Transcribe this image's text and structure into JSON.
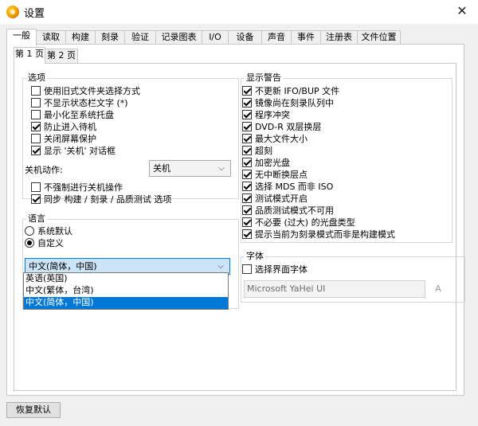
{
  "window": {
    "title": "设置",
    "close_glyph": "✕"
  },
  "tabs": [
    {
      "label": "一般",
      "active": true
    },
    {
      "label": "读取"
    },
    {
      "label": "构建"
    },
    {
      "label": "刻录"
    },
    {
      "label": "验证"
    },
    {
      "label": "记录图表"
    },
    {
      "label": "I/O"
    },
    {
      "label": "设备"
    },
    {
      "label": "声音"
    },
    {
      "label": "事件"
    },
    {
      "label": "注册表"
    },
    {
      "label": "文件位置"
    }
  ],
  "subtabs": [
    {
      "label": "第 1 页",
      "active": true
    },
    {
      "label": "第 2 页"
    }
  ],
  "options": {
    "legend": "选项",
    "items": [
      {
        "label": "使用旧式文件夹选择方式",
        "checked": false
      },
      {
        "label": "不显示状态栏文字 (*)",
        "checked": false
      },
      {
        "label": "最小化至系统托盘",
        "checked": false
      },
      {
        "label": "防止进入待机",
        "checked": true
      },
      {
        "label": "关闭屏幕保护",
        "checked": false
      },
      {
        "label": "显示 '关机' 对话框",
        "checked": true
      }
    ],
    "shutdown_label": "关机动作:",
    "shutdown_value": "关机",
    "items2": [
      {
        "label": "不强制进行关机操作",
        "checked": false
      },
      {
        "label": "同步 构建 / 刻录 / 品质测试 选项",
        "checked": true
      }
    ]
  },
  "language": {
    "legend": "语言",
    "radio_default": "系统默认",
    "radio_custom": "自定义",
    "selected_value": "中文(简体，中国)",
    "options": [
      {
        "label": "英语(英国)",
        "selected": false
      },
      {
        "label": "中文(繁体，台湾)",
        "selected": false
      },
      {
        "label": "中文(简体，中国)",
        "selected": true
      }
    ]
  },
  "warnings": {
    "legend": "显示警告",
    "items": [
      {
        "label": "不更新 IFO/BUP 文件",
        "checked": true
      },
      {
        "label": "镜像尚在刻录队列中",
        "checked": true
      },
      {
        "label": "程序冲突",
        "checked": true
      },
      {
        "label": "DVD-R 双层换层",
        "checked": true
      },
      {
        "label": "最大文件大小",
        "checked": true
      },
      {
        "label": "超刻",
        "checked": true
      },
      {
        "label": "加密光盘",
        "checked": true
      },
      {
        "label": "无中断换层点",
        "checked": true
      },
      {
        "label": "选择 MDS 而非 ISO",
        "checked": true
      },
      {
        "label": "测试模式开启",
        "checked": true
      },
      {
        "label": "品质测试模式不可用",
        "checked": true
      },
      {
        "label": "不必要 (过大) 的光盘类型",
        "checked": true
      },
      {
        "label": "提示当前为刻录模式而非是构建模式",
        "checked": true
      }
    ]
  },
  "font": {
    "legend": "字体",
    "checkbox_label": "选择界面字体",
    "checkbox_checked": false,
    "font_name": "Microsoft YaHei UI",
    "button_glyph": "A"
  },
  "footer": {
    "restore_label": "恢复默认"
  }
}
